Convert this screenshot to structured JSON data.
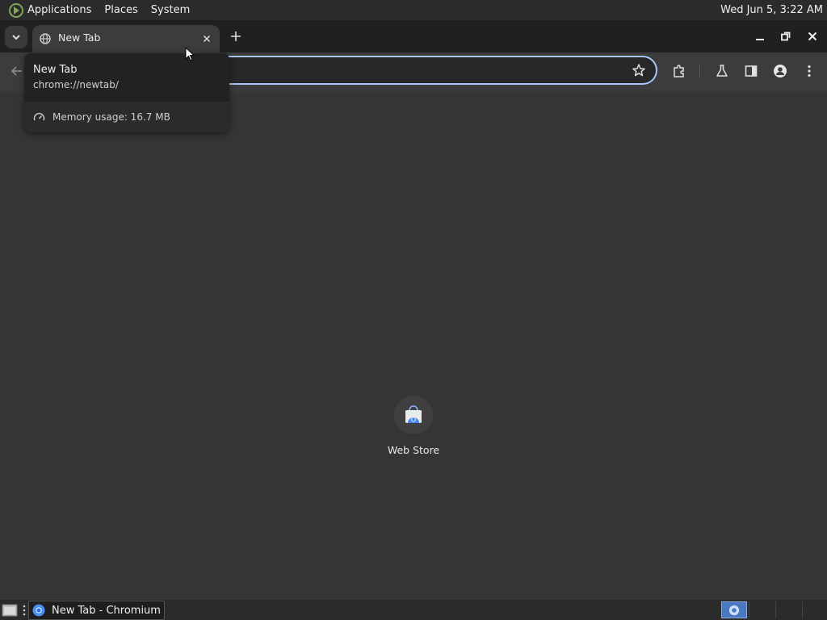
{
  "top_panel": {
    "menus": [
      "Applications",
      "Places",
      "System"
    ],
    "clock": "Wed Jun  5,  3:22 AM"
  },
  "browser": {
    "tab": {
      "title": "New Tab",
      "favicon": "globe-icon"
    },
    "omnibox": {
      "value": ""
    },
    "colors": {
      "focus_ring": "#a8c7fa",
      "background": "#353535",
      "accent": "#4a78c0"
    }
  },
  "hover_card": {
    "title": "New Tab",
    "url": "chrome://newtab/",
    "memory": "Memory usage: 16.7 MB"
  },
  "shortcuts": [
    {
      "label": "Web Store",
      "icon": "web-store-icon"
    }
  ],
  "taskbar": {
    "window_label": "New Tab - Chromium"
  }
}
